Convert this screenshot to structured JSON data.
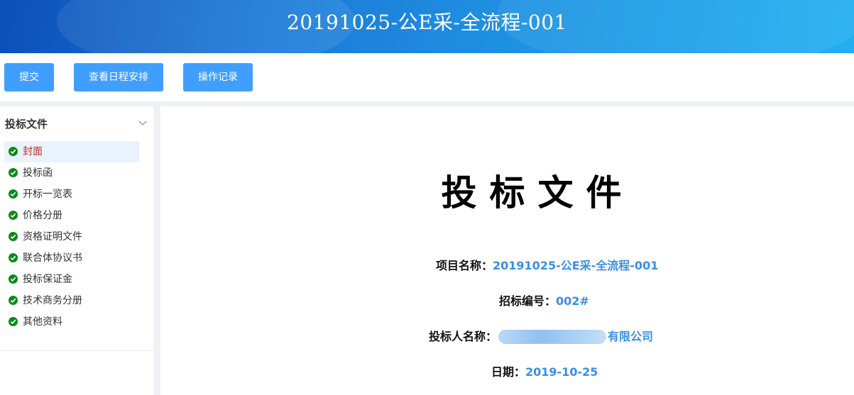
{
  "header": {
    "title": "20191025-公E采-全流程-001"
  },
  "toolbar": {
    "submit_label": "提交",
    "schedule_label": "查看日程安排",
    "log_label": "操作记录"
  },
  "sidebar": {
    "heading": "投标文件",
    "items": [
      {
        "label": "封面",
        "active": true
      },
      {
        "label": "投标函"
      },
      {
        "label": "开标一览表"
      },
      {
        "label": "价格分册"
      },
      {
        "label": "资格证明文件"
      },
      {
        "label": "联合体协议书"
      },
      {
        "label": "投标保证金"
      },
      {
        "label": "技术商务分册"
      },
      {
        "label": "其他资料"
      }
    ]
  },
  "document": {
    "title": "投标文件",
    "project_name_label": "项目名称：",
    "project_name_value": "20191025-公E采-全流程-001",
    "bid_no_label": "招标编号：",
    "bid_no_value": "002#",
    "bidder_label": "投标人名称：",
    "bidder_value_visible": "有限公司",
    "date_label": "日期：",
    "date_value": "2019-10-25"
  },
  "colors": {
    "accent": "#409eff",
    "check": "#0a8a16",
    "active_text": "#d0281f",
    "value_text": "#3a8ee6"
  }
}
